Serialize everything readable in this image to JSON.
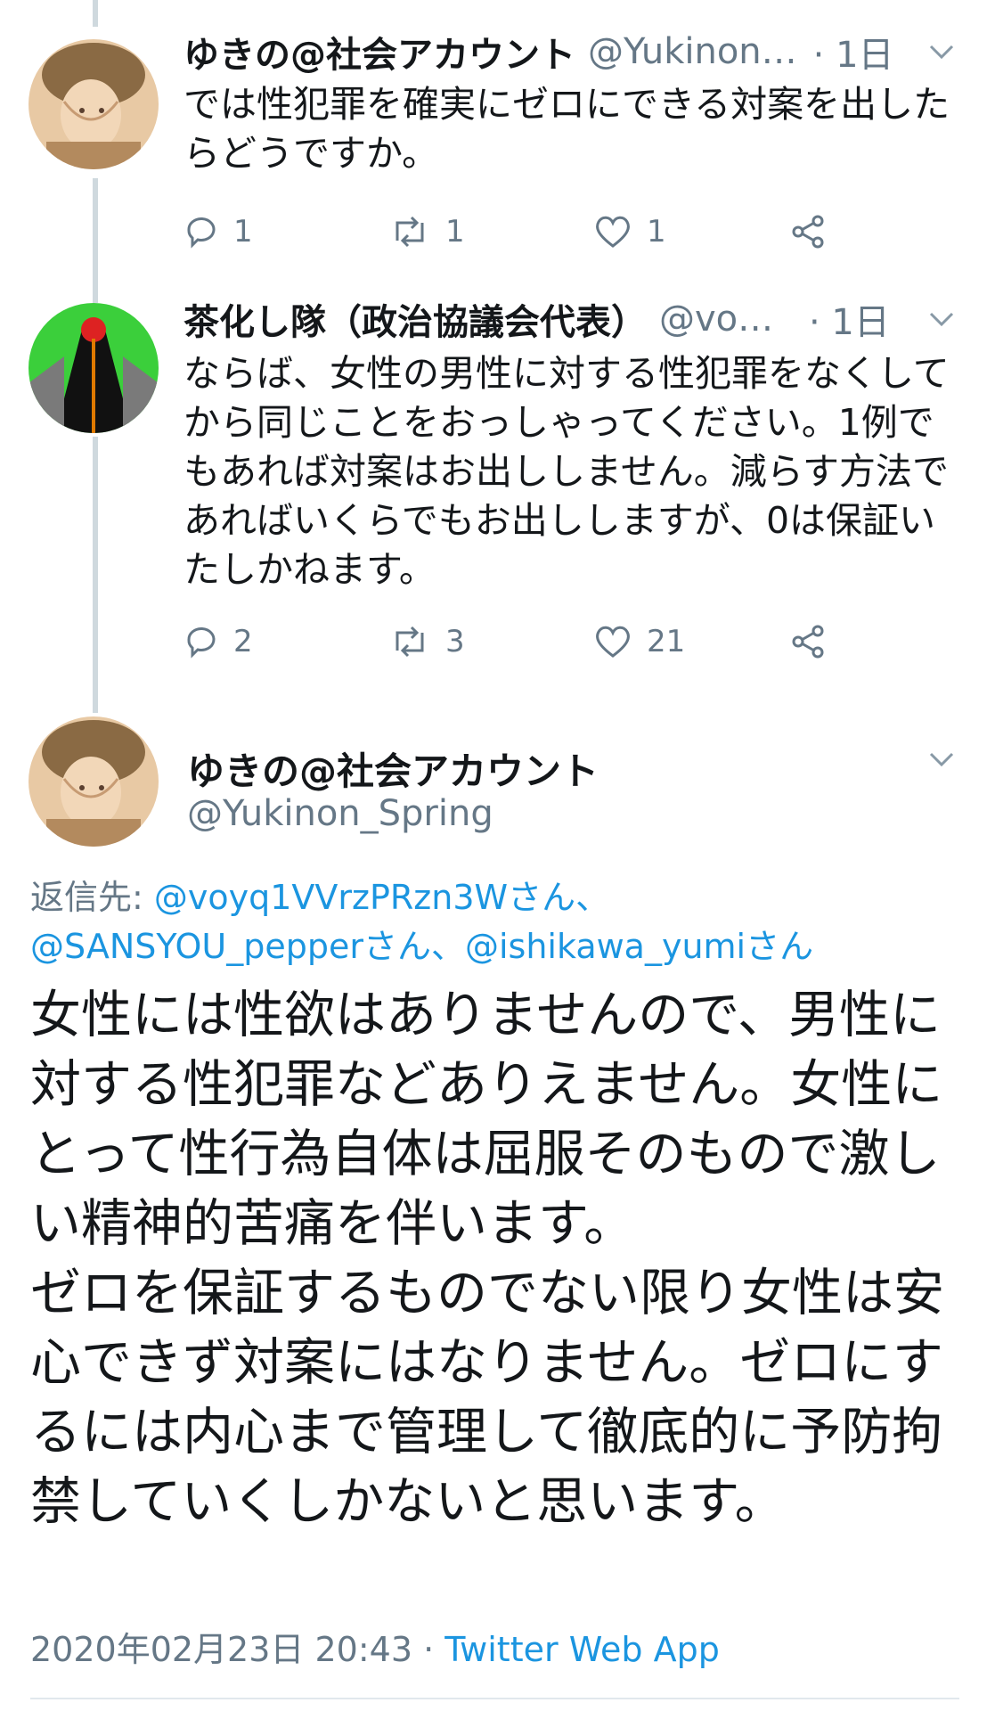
{
  "tweets": [
    {
      "name": "ゆきの@社会アカウント",
      "handle": "@Yukinon…",
      "time": "· 1日",
      "text": "では性犯罪を確実にゼロにできる対案を出したらどうですか。",
      "replies": "1",
      "retweets": "1",
      "likes": "1"
    },
    {
      "name": "茶化し隊（政治協議会代表）",
      "handle": "@voy…",
      "time": "· 1日",
      "text": "ならば、女性の男性に対する性犯罪をなくしてから同じことをおっしゃってください。1例でもあれば対案はお出ししません。減らす方法であればいくらでもお出ししますが、0は保証いたしかねます。",
      "replies": "2",
      "retweets": "3",
      "likes": "21"
    }
  ],
  "main_tweet": {
    "name": "ゆきの@社会アカウント",
    "handle": "@Yukinon_Spring",
    "reply_prefix": "返信先: ",
    "reply_to_1": "@voyq1VVrzPRzn3Wさん、",
    "reply_to_2": "@SANSYOU_pepperさん、",
    "reply_to_3": "@ishikawa_yumiさん",
    "text": "女性には性欲はありませんので、男性に対する性犯罪などありえません。女性にとって性行為自体は屈服そのもので激しい精神的苦痛を伴います。\nゼロを保証するものでない限り女性は安心できず対案にはなりません。ゼロにするには内心まで管理して徹底的に予防拘禁していくしかないと思います。",
    "timestamp": "2020年02月23日 20:43 · ",
    "app": "Twitter Web App"
  },
  "icons": {
    "reply": "reply-icon",
    "retweet": "retweet-icon",
    "like": "heart-icon",
    "share": "share-icon",
    "menu": "chevron-down-icon"
  },
  "colors": {
    "link": "#1b95e0",
    "secondary_text": "#657786",
    "thread_line": "#cfd9de"
  }
}
